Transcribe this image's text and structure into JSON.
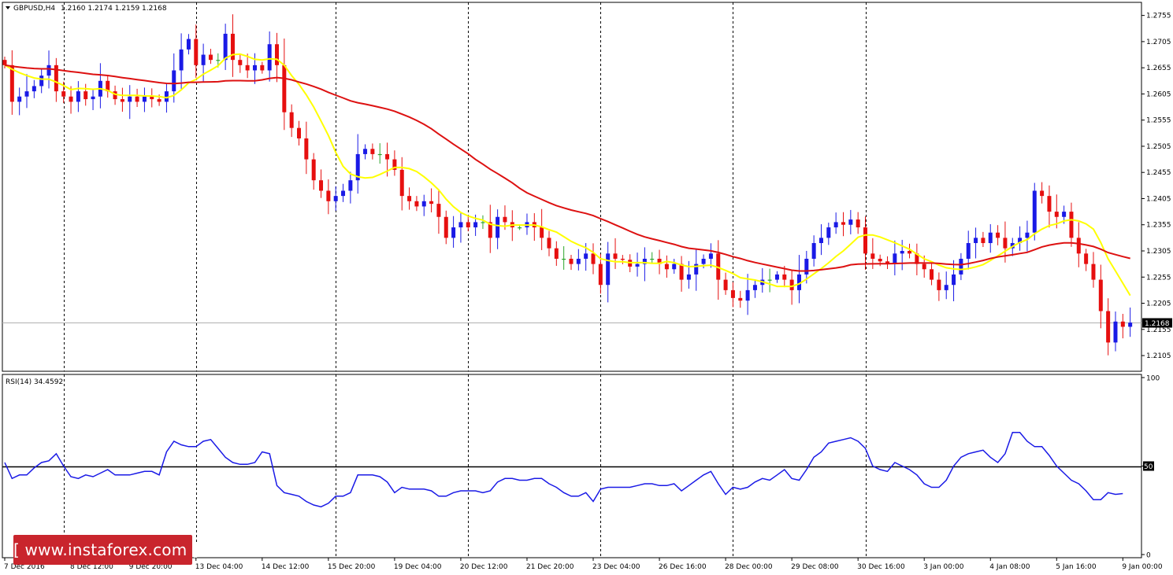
{
  "header": {
    "symbol": "GBPUSD,H4",
    "ohlc": "1.2160 1.2174 1.2159 1.2168",
    "rsi_label": "RSI(14) 34.4592"
  },
  "watermark": {
    "text": "[ www.instaforex.com ]"
  },
  "colors": {
    "bull": "#1a1ae6",
    "bear": "#e60f0f",
    "doji": "#2da52d",
    "ma_fast": "#ffff00",
    "ma_slow": "#dd1111",
    "rsi": "#1a1ae6",
    "price_tag_bg": "#000000",
    "price_tag_text": "#ffffff"
  },
  "chart_data": [
    {
      "type": "candlestick",
      "title": "GBPUSD,H4",
      "ylim": [
        1.2075,
        1.278
      ],
      "current_price": 1.2168,
      "current_price_label": "1.2168",
      "y_ticks": [
        {
          "value": 1.2755,
          "label": "1.2755"
        },
        {
          "value": 1.2705,
          "label": "1.2705"
        },
        {
          "value": 1.2655,
          "label": "1.2655"
        },
        {
          "value": 1.2605,
          "label": "1.2605"
        },
        {
          "value": 1.2555,
          "label": "1.2555"
        },
        {
          "value": 1.2505,
          "label": "1.2505"
        },
        {
          "value": 1.2455,
          "label": "1.2455"
        },
        {
          "value": 1.2405,
          "label": "1.2405"
        },
        {
          "value": 1.2355,
          "label": "1.2355"
        },
        {
          "value": 1.2305,
          "label": "1.2305"
        },
        {
          "value": 1.2255,
          "label": "1.2255"
        },
        {
          "value": 1.2205,
          "label": "1.2205"
        },
        {
          "value": 1.2155,
          "label": "1.2155"
        },
        {
          "value": 1.2105,
          "label": "1.2105"
        }
      ],
      "x_labels": [
        "7 Dec 2016",
        "8 Dec 12:00",
        "9 Dec 20:00",
        "13 Dec 04:00",
        "14 Dec 12:00",
        "15 Dec 20:00",
        "19 Dec 04:00",
        "20 Dec 12:00",
        "21 Dec 20:00",
        "23 Dec 04:00",
        "26 Dec 16:00",
        "28 Dec 00:00",
        "29 Dec 08:00",
        "30 Dec 16:00",
        "3 Jan 00:00",
        "4 Jan 08:00",
        "5 Jan 16:00",
        "9 Jan 00:00"
      ],
      "period_separators": [
        8,
        26,
        45,
        63,
        81,
        99,
        117
      ],
      "close": [
        1.266,
        1.259,
        1.26,
        1.261,
        1.262,
        1.264,
        1.266,
        1.261,
        1.26,
        1.259,
        1.261,
        1.2595,
        1.26,
        1.263,
        1.261,
        1.2595,
        1.259,
        1.26,
        1.259,
        1.26,
        1.2595,
        1.259,
        1.261,
        1.265,
        1.269,
        1.271,
        1.266,
        1.268,
        1.267,
        1.267,
        1.272,
        1.267,
        1.266,
        1.265,
        1.266,
        1.265,
        1.27,
        1.266,
        1.257,
        1.254,
        1.252,
        1.248,
        1.244,
        1.242,
        1.24,
        1.241,
        1.242,
        1.244,
        1.249,
        1.25,
        1.249,
        1.249,
        1.248,
        1.246,
        1.241,
        1.24,
        1.239,
        1.24,
        1.2395,
        1.237,
        1.233,
        1.235,
        1.236,
        1.235,
        1.236,
        1.236,
        1.233,
        1.237,
        1.236,
        1.235,
        1.235,
        1.236,
        1.235,
        1.233,
        1.231,
        1.229,
        1.229,
        1.228,
        1.229,
        1.23,
        1.228,
        1.224,
        1.23,
        1.229,
        1.2288,
        1.2275,
        1.228,
        1.229,
        1.229,
        1.228,
        1.227,
        1.228,
        1.225,
        1.226,
        1.228,
        1.229,
        1.23,
        1.225,
        1.223,
        1.2215,
        1.221,
        1.223,
        1.224,
        1.225,
        1.225,
        1.226,
        1.225,
        1.223,
        1.226,
        1.229,
        1.232,
        1.233,
        1.235,
        1.236,
        1.2355,
        1.2365,
        1.235,
        1.23,
        1.229,
        1.2285,
        1.228,
        1.23,
        1.2305,
        1.23,
        1.228,
        1.227,
        1.225,
        1.223,
        1.224,
        1.226,
        1.229,
        1.232,
        1.233,
        1.232,
        1.234,
        1.233,
        1.231,
        1.232,
        1.233,
        1.234,
        1.242,
        1.241,
        1.238,
        1.237,
        1.238,
        1.233,
        1.23,
        1.228,
        1.225,
        1.219,
        1.213,
        1.217,
        1.216,
        1.2168
      ],
      "series": [
        {
          "name": "MA fast",
          "style": "yellow line"
        },
        {
          "name": "MA slow",
          "style": "red line"
        }
      ]
    },
    {
      "type": "line",
      "title": "RSI(14) 34.4592",
      "ylim": [
        0,
        100
      ],
      "y_ticks": [
        {
          "value": 100,
          "label": "100"
        },
        {
          "value": 50,
          "label": "50"
        },
        {
          "value": 0,
          "label": "0"
        }
      ],
      "level": 50,
      "level_label": "50",
      "series": [
        {
          "name": "RSI(14)",
          "values": [
            52,
            43,
            45,
            45,
            49,
            52,
            53,
            57,
            50,
            44,
            43,
            45,
            44,
            46,
            48,
            45,
            45,
            45,
            46,
            47,
            47,
            45,
            58,
            64,
            62,
            61,
            61,
            64,
            65,
            60,
            55,
            52,
            51,
            51,
            52,
            58,
            57,
            39,
            35,
            34,
            33,
            30,
            28,
            27,
            29,
            33,
            33,
            35,
            45,
            45,
            45,
            44,
            41,
            35,
            38,
            37,
            37,
            37,
            36,
            33,
            33,
            35,
            36,
            36,
            36,
            35,
            36,
            41,
            43,
            43,
            42,
            42,
            43,
            43,
            40,
            38,
            35,
            33,
            33,
            35,
            30,
            37,
            38,
            38,
            38,
            38,
            39,
            40,
            40,
            39,
            39,
            40,
            36,
            39,
            42,
            45,
            47,
            40,
            34,
            38,
            37,
            38,
            41,
            43,
            42,
            45,
            48,
            43,
            42,
            48,
            55,
            58,
            63,
            64,
            65,
            66,
            64,
            60,
            50,
            48,
            47,
            52,
            50,
            48,
            45,
            40,
            38,
            38,
            42,
            50,
            55,
            57,
            58,
            59,
            55,
            52,
            57,
            69,
            69,
            64,
            61,
            61,
            56,
            50,
            46,
            42,
            40,
            36,
            31,
            31,
            35,
            34,
            34.4592
          ]
        }
      ]
    }
  ]
}
